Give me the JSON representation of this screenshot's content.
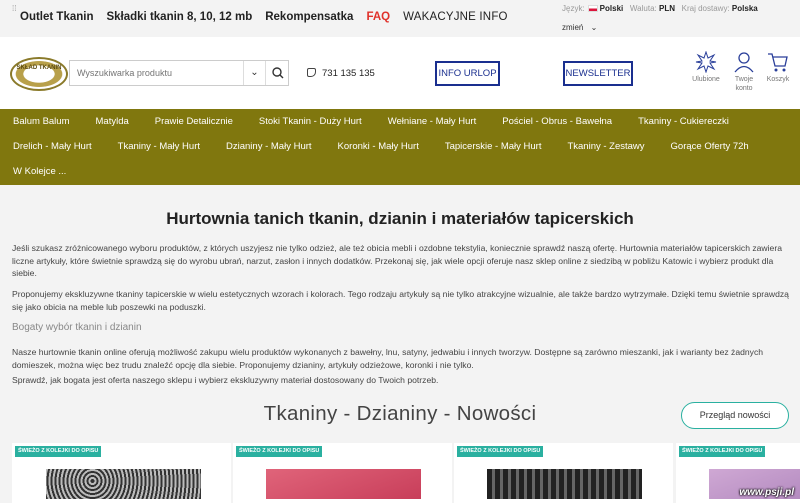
{
  "topnav": {
    "items": [
      "Outlet Tkanin",
      "Składki tkanin 8, 10, 12 mb",
      "Rekompensatka",
      "FAQ",
      "WAKACYJNE INFO"
    ]
  },
  "prefs": {
    "lang_label": "Język:",
    "lang_value": "Polski",
    "currency_label": "Waluta:",
    "currency_value": "PLN",
    "country_label": "Kraj dostawy:",
    "country_value": "Polska",
    "change": "zmień"
  },
  "header": {
    "logo_text": "SKŁAD TKANIN",
    "search_placeholder": "Wyszukiwarka produktu",
    "phone": "731 135 135",
    "btn_urlop": "INFO URLOP",
    "btn_newsletter": "NEWSLETTER",
    "fav": "Ulubione",
    "account": "Twoje konto",
    "cart": "Koszyk"
  },
  "menu": {
    "row1": [
      "Balum Balum",
      "Matylda",
      "Prawie Detalicznie",
      "Stoki Tkanin - Duży Hurt",
      "Wełniane - Mały Hurt",
      "Pościel - Obrus - Bawełna",
      "Tkaniny - Cukiereczki"
    ],
    "row2": [
      "Drelich - Mały Hurt",
      "Tkaniny - Mały Hurt",
      "Dzianiny - Mały Hurt",
      "Koronki - Mały Hurt",
      "Tapicerskie - Mały Hurt",
      "Tkaniny - Zestawy",
      "Gorące Oferty 72h"
    ],
    "row3": [
      "W Kolejce ..."
    ]
  },
  "content": {
    "title": "Hurtownia tanich tkanin, dzianin i materiałów tapicerskich",
    "p1": "Jeśli szukasz zróżnicowanego wyboru produktów, z których uszyjesz nie tylko odzież, ale też obicia mebli i ozdobne tekstylia, koniecznie sprawdź naszą ofertę. Hurtownia materiałów tapicerskich zawiera liczne artykuły, które świetnie sprawdzą się do wyrobu ubrań, narzut, zasłon i innych dodatków. Przekonaj się, jak wiele opcji oferuje nasz sklep online z siedzibą w pobliżu Katowic i wybierz produkt dla siebie.",
    "p2": "Proponujemy ekskluzywne tkaniny tapicerskie w wielu estetycznych wzorach i kolorach. Tego rodzaju artykuły są nie tylko atrakcyjne wizualnie, ale także bardzo wytrzymałe. Dzięki temu świetnie sprawdzą się jako obicia na meble lub poszewki na poduszki.",
    "subtitle": "Bogaty wybór tkanin i dzianin",
    "p4": "Nasze hurtownie tkanin online oferują możliwość zakupu wielu produktów wykonanych z bawełny, lnu, satyny, jedwabiu i innych tworzyw. Dostępne są zarówno mieszanki, jak i warianty bez żadnych domieszek, można więc bez trudu znaleźć opcję dla siebie. Proponujemy dzianiny, artykuły odzieżowe, koronki i nie tylko.",
    "p5": "Sprawdź, jak bogata jest oferta naszego sklepu i wybierz ekskluzywny materiał dostosowany do Twoich potrzeb.",
    "section_title": "Tkaniny - Dzianiny - Nowości",
    "more_button": "Przegląd nowości",
    "badge": "ŚWIEŻO Z KOLEJKI DO OPISU"
  },
  "watermark": "www.psji.pl",
  "colors": {
    "menu_bg": "#80770e",
    "accent_blue": "#1a2f8f",
    "teal": "#2ab0a0",
    "faq_red": "#e0312a"
  }
}
